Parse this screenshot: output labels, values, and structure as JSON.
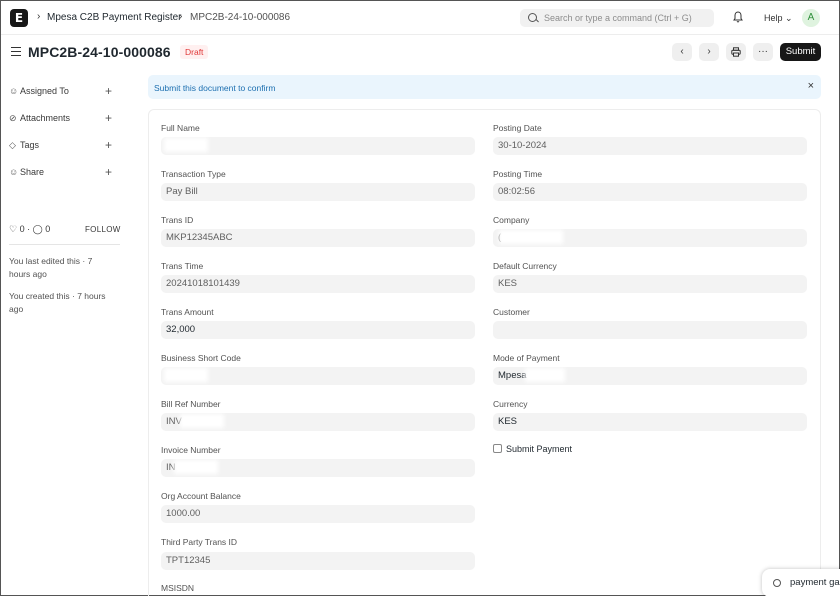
{
  "navbar": {
    "logo_letter": "E",
    "breadcrumbs": [
      "Mpesa C2B Payment Register",
      "MPC2B-24-10-000086"
    ],
    "search_placeholder": "Search or type a command (Ctrl + G)",
    "help_label": "Help",
    "avatar_letter": "A"
  },
  "header": {
    "title": "MPC2B-24-10-000086",
    "status": "Draft",
    "more_label": "···",
    "submit_label": "Submit"
  },
  "sidebar": {
    "items": [
      {
        "label": "Assigned To",
        "icon": "assign-icon"
      },
      {
        "label": "Attachments",
        "icon": "paperclip-icon"
      },
      {
        "label": "Tags",
        "icon": "tag-icon"
      },
      {
        "label": "Share",
        "icon": "share-icon"
      }
    ],
    "likes_count": "0",
    "comments_count": "0",
    "follow_label": "FOLLOW",
    "last_edited": "You last edited this · 7 hours ago",
    "created": "You created this · 7 hours ago"
  },
  "alert": {
    "text": "Submit this document to confirm",
    "close": "×"
  },
  "form": {
    "left": [
      {
        "label": "Full Name",
        "value": ""
      },
      {
        "label": "Transaction Type",
        "value": "Pay Bill"
      },
      {
        "label": "Trans ID",
        "value": "MKP12345ABC"
      },
      {
        "label": "Trans Time",
        "value": "20241018101439"
      },
      {
        "label": "Trans Amount",
        "value": "32,000"
      },
      {
        "label": "Business Short Code",
        "value": ""
      },
      {
        "label": "Bill Ref Number",
        "value": "INV"
      },
      {
        "label": "Invoice Number",
        "value": "IN"
      },
      {
        "label": "Org Account Balance",
        "value": "1000.00"
      },
      {
        "label": "Third Party Trans ID",
        "value": "TPT12345"
      },
      {
        "label": "MSISDN",
        "value": ""
      }
    ],
    "right": [
      {
        "label": "Posting Date",
        "value": "30-10-2024"
      },
      {
        "label": "Posting Time",
        "value": "08:02:56"
      },
      {
        "label": "Company",
        "value": "("
      },
      {
        "label": "Default Currency",
        "value": "KES"
      },
      {
        "label": "Customer",
        "value": ""
      },
      {
        "label": "Mode of Payment",
        "value": "Mpesa"
      },
      {
        "label": "Currency",
        "value": "KES"
      }
    ],
    "checkbox_label": "Submit Payment"
  },
  "search_popup": {
    "text": "payment ga"
  }
}
